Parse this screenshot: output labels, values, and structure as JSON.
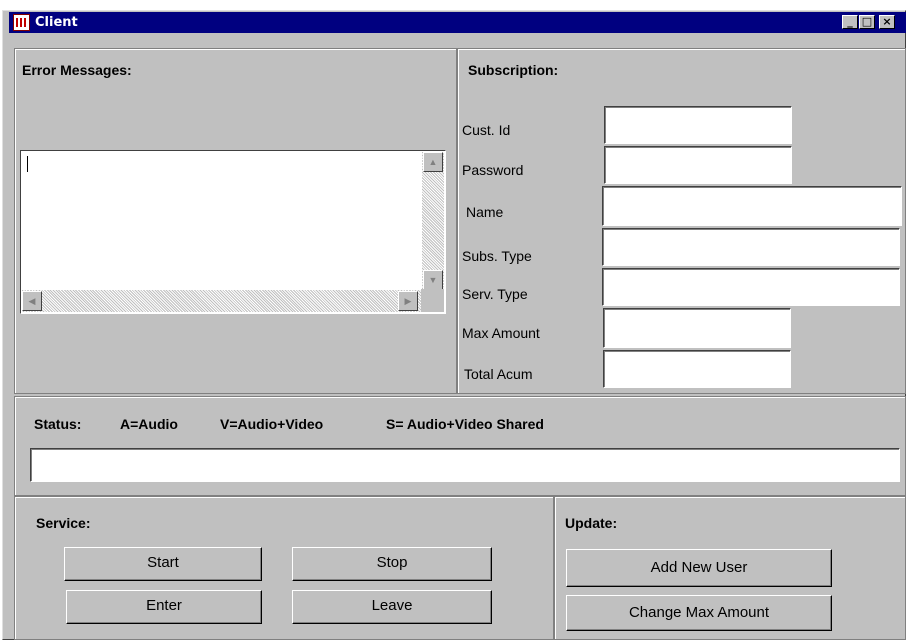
{
  "window": {
    "title": "Client",
    "minimize_glyph": "_",
    "maximize_glyph": "□",
    "close_glyph": "×",
    "app_icon": "java-app-icon"
  },
  "error_panel": {
    "heading": "Error Messages:",
    "text_value": ""
  },
  "subscription": {
    "heading": "Subscription:",
    "fields": [
      {
        "label": "Cust. Id",
        "value": ""
      },
      {
        "label": "Password",
        "value": ""
      },
      {
        "label": "Name",
        "value": ""
      },
      {
        "label": "Subs. Type",
        "value": ""
      },
      {
        "label": "Serv. Type",
        "value": ""
      },
      {
        "label": "Max Amount",
        "value": ""
      },
      {
        "label": "Total Acum",
        "value": ""
      }
    ]
  },
  "status": {
    "heading": "Status:",
    "legend_audio": "A=Audio",
    "legend_video": "V=Audio+Video",
    "legend_shared": "S= Audio+Video Shared",
    "value": ""
  },
  "service": {
    "heading": "Service:",
    "start": "Start",
    "stop": "Stop",
    "enter": "Enter",
    "leave": "Leave"
  },
  "update": {
    "heading": "Update:",
    "add_user": "Add New User",
    "change_max": "Change Max Amount"
  },
  "scroll_arrows": {
    "up": "▲",
    "down": "▼",
    "left": "◀",
    "right": "▶"
  },
  "colors": {
    "titlebar": "#000080",
    "face": "#c0c0c0",
    "field_bg": "#ffffff"
  }
}
